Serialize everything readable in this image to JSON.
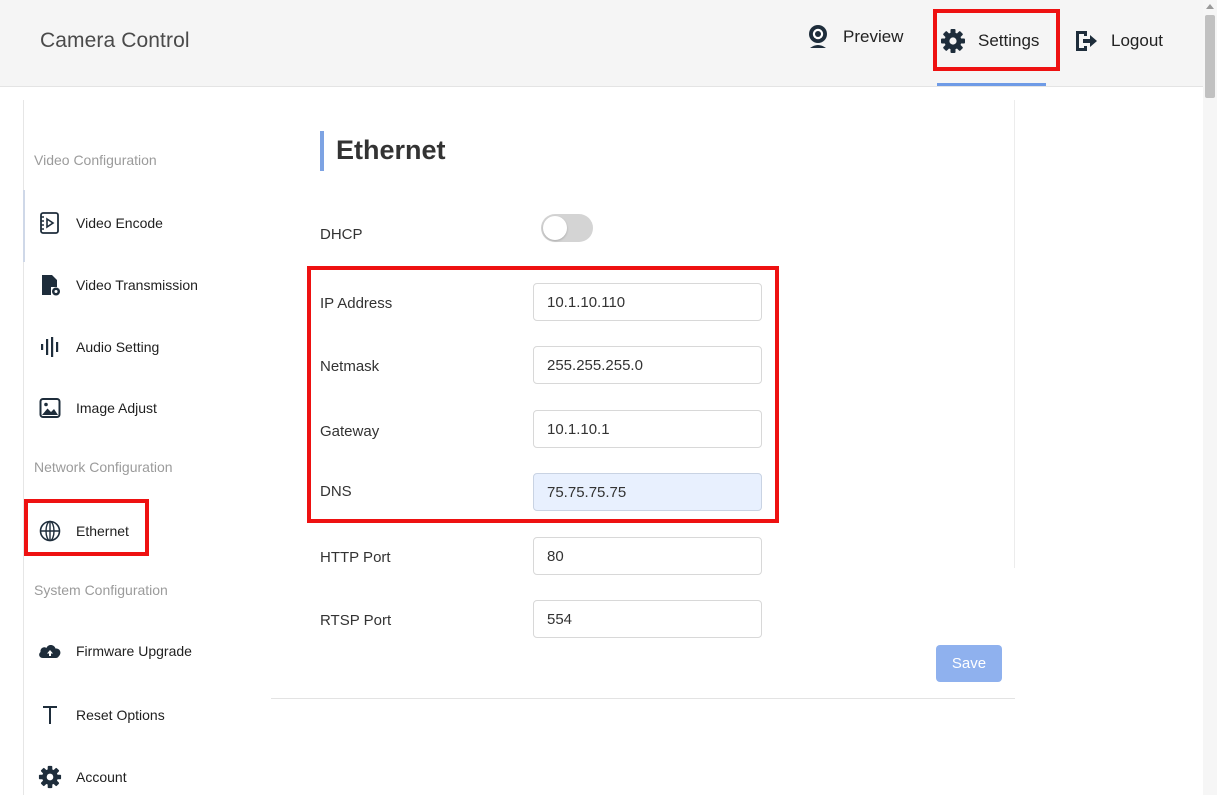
{
  "header": {
    "title": "Camera Control",
    "nav": [
      {
        "label": "Preview",
        "icon": "webcam-icon"
      },
      {
        "label": "Settings",
        "icon": "gear-icon",
        "active": true
      },
      {
        "label": "Logout",
        "icon": "logout-icon"
      }
    ]
  },
  "sidebar": {
    "sections": [
      {
        "heading": "Video Configuration",
        "items": [
          {
            "label": "Video Encode",
            "icon": "video-file-icon"
          },
          {
            "label": "Video Transmission",
            "icon": "file-gear-icon"
          },
          {
            "label": "Audio Setting",
            "icon": "audio-bars-icon"
          },
          {
            "label": "Image Adjust",
            "icon": "image-icon"
          }
        ]
      },
      {
        "heading": "Network Configuration",
        "items": [
          {
            "label": "Ethernet",
            "icon": "globe-icon",
            "active": true
          }
        ]
      },
      {
        "heading": "System Configuration",
        "items": [
          {
            "label": "Firmware Upgrade",
            "icon": "cloud-upload-icon"
          },
          {
            "label": "Reset Options",
            "icon": "reset-t-icon"
          },
          {
            "label": "Account",
            "icon": "gear-icon"
          }
        ]
      }
    ]
  },
  "main": {
    "title": "Ethernet",
    "dhcp": {
      "label": "DHCP",
      "enabled": false
    },
    "fields": [
      {
        "label": "IP Address",
        "value": "10.1.10.110"
      },
      {
        "label": "Netmask",
        "value": "255.255.255.0"
      },
      {
        "label": "Gateway",
        "value": "10.1.10.1"
      },
      {
        "label": "DNS",
        "value": "75.75.75.75"
      },
      {
        "label": "HTTP Port",
        "value": "80"
      },
      {
        "label": "RTSP Port",
        "value": "554"
      }
    ],
    "save_label": "Save"
  },
  "colors": {
    "accent": "#6f9be6",
    "save_button": "#8fb1ee",
    "annotation": "#ee1111",
    "autofill_bg": "#e8f0fe"
  }
}
